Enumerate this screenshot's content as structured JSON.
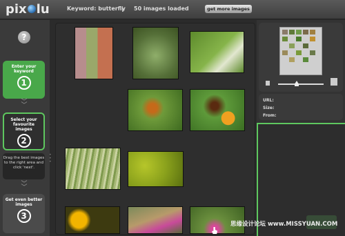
{
  "app": {
    "logo_text_left": "pix",
    "logo_text_right": "lu",
    "keyword_text": "Keyword: butterfly",
    "separator": "|",
    "images_loaded_text": "50 images loaded",
    "more_button_label": "get more images"
  },
  "steps": [
    {
      "title": "Enter your keyword",
      "number": "1"
    },
    {
      "title": "Select your favourite images",
      "number": "2"
    },
    {
      "title": "Get even better images",
      "number": "3"
    }
  ],
  "help_label": "?",
  "hint_text": "Drag the best images to the right area and click 'next'.",
  "info": {
    "url_label": "URL:",
    "size_label": "Size:",
    "from_label": "From:"
  },
  "watermark": "思缘设计论坛 www.MISSYUAN.COM",
  "thumbnails": [
    {
      "subject": "butterfly on flowers by wall"
    },
    {
      "subject": "garden shrub"
    },
    {
      "subject": "white butterfly on leaf"
    },
    {
      "subject": "monarch butterfly on bush"
    },
    {
      "subject": "butterfly on orange flowers"
    },
    {
      "subject": "ornamental grass"
    },
    {
      "subject": "green shrub"
    },
    {
      "subject": "yellow flowers"
    },
    {
      "subject": "butterfly in flower bed"
    },
    {
      "subject": "purple flowers"
    }
  ]
}
